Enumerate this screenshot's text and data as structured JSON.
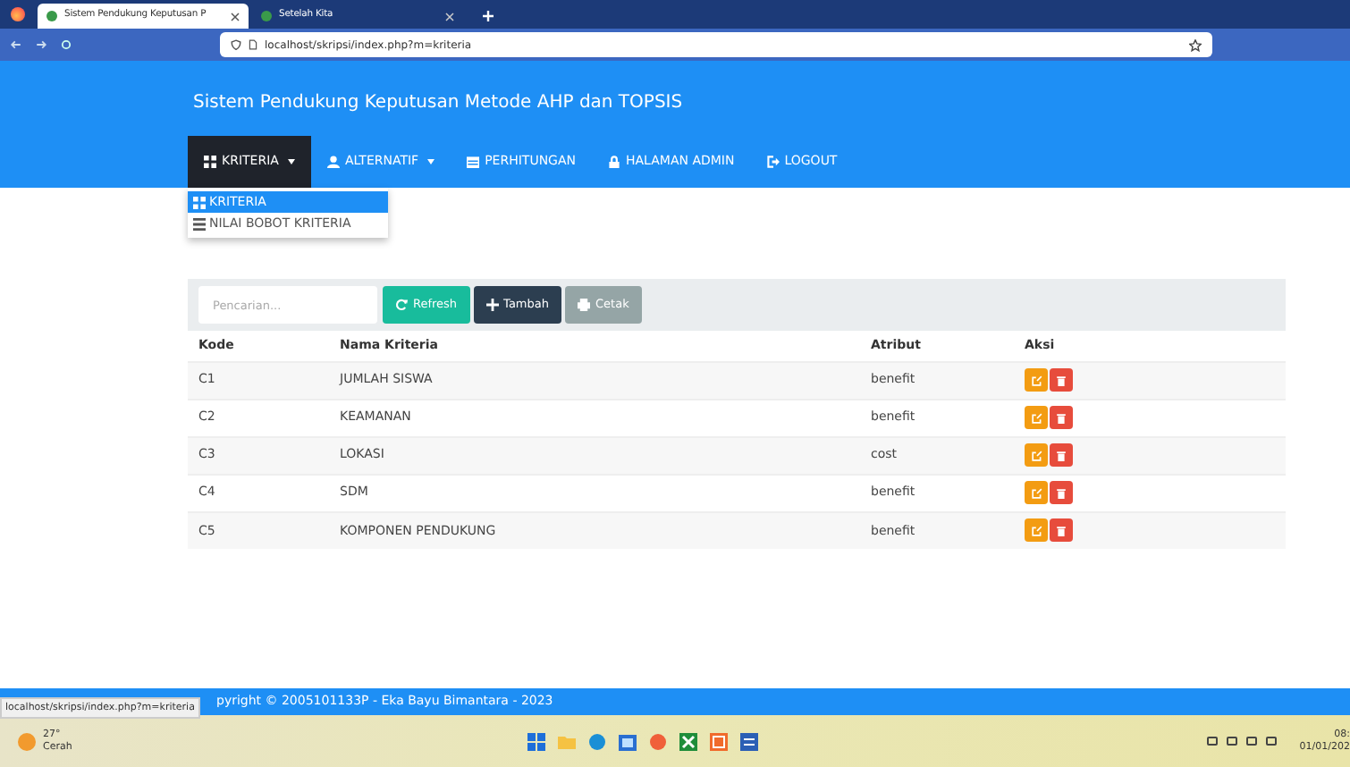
{
  "browser": {
    "tabs": [
      {
        "title": "Sistem Pendukung Keputusan P",
        "selected": true
      },
      {
        "title": "Setelah Kita",
        "selected": false
      }
    ],
    "url": "localhost/skripsi/index.php?m=kriteria"
  },
  "app": {
    "title": "Sistem Pendukung Keputusan Metode AHP dan TOPSIS",
    "menu": [
      {
        "label": "KRITERIA",
        "kind": "grid",
        "caret": true,
        "selected": true
      },
      {
        "label": "ALTERNATIF",
        "kind": "user",
        "caret": true,
        "selected": false
      },
      {
        "label": "PERHITUNGAN",
        "kind": "calendar",
        "caret": false,
        "selected": false
      },
      {
        "label": "HALAMAN ADMIN",
        "kind": "lock",
        "caret": false,
        "selected": false
      },
      {
        "label": "LOGOUT",
        "kind": "logout",
        "caret": false,
        "selected": false
      }
    ],
    "dropdown": [
      {
        "label": "KRITERIA",
        "kind": "grid",
        "selected": true
      },
      {
        "label": "NILAI BOBOT KRITERIA",
        "kind": "list",
        "selected": false
      }
    ],
    "search": {
      "placeholder": "Pencarian..."
    },
    "buttons": [
      {
        "label": "Refresh",
        "kind": "refresh"
      },
      {
        "label": "Tambah",
        "kind": "add"
      },
      {
        "label": "Cetak",
        "kind": "print"
      }
    ],
    "table": {
      "columns": [
        "Kode",
        "Nama Kriteria",
        "Atribut",
        "Aksi"
      ],
      "rows": [
        [
          "C1",
          "JUMLAH SISWA",
          "benefit"
        ],
        [
          "C2",
          "KEAMANAN",
          "benefit"
        ],
        [
          "C3",
          "LOKASI",
          "cost"
        ],
        [
          "C4",
          "SDM",
          "benefit"
        ],
        [
          "C5",
          "KOMPONEN PENDUKUNG",
          "benefit"
        ]
      ]
    },
    "footer": "pyright © 2005101133P - Eka Bayu Bimantara - 2023",
    "status_url": "localhost/skripsi/index.php?m=kriteria"
  },
  "taskbar": {
    "temperature": "27°",
    "weather": "Cerah",
    "time": "08:",
    "date": "01/01/202"
  }
}
